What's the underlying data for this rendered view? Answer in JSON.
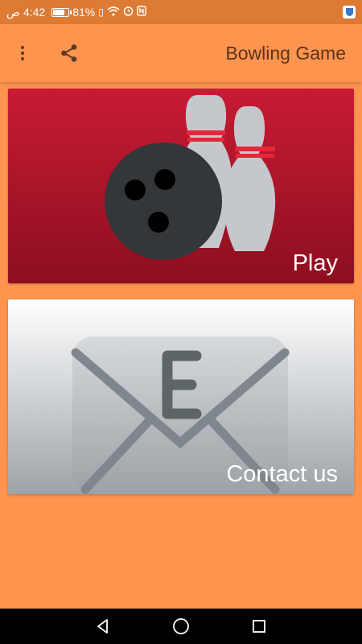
{
  "status_bar": {
    "time": "4:42",
    "am_pm": "ص",
    "battery": "81%",
    "icons": [
      "battery-icon",
      "sim-icon",
      "wifi-icon",
      "alarm-icon",
      "nfc-icon",
      "vpn-shield-icon"
    ]
  },
  "app_bar": {
    "title": "Bowling Game",
    "icons": [
      "more-vert-icon",
      "share-icon"
    ]
  },
  "cards": [
    {
      "label": "Play",
      "image": "bowling-ball-pins-icon"
    },
    {
      "label": "Contact us",
      "image": "envelope-e-icon"
    }
  ],
  "nav_bar": {
    "icons": [
      "back-icon",
      "home-icon",
      "recents-icon"
    ]
  },
  "colors": {
    "background": "#FF944F",
    "status_bar": "#DD7A33",
    "title_text": "#5A3418",
    "play_card": "#C81B34",
    "contact_card": "#D9DCDF"
  }
}
